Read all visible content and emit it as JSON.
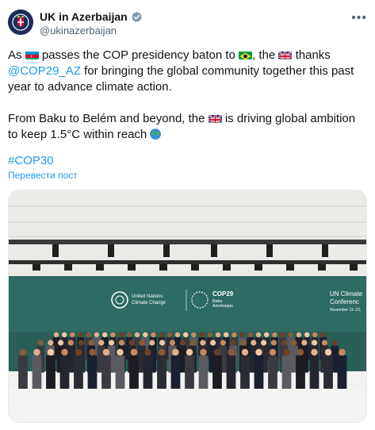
{
  "account": {
    "display_name": "UK in Azerbaijan",
    "handle": "@ukinazerbaijan",
    "avatar": "uk-crest-avatar",
    "verified_icon": "verified-badge-icon"
  },
  "post": {
    "p1_a": "As",
    "p1_b": "passes the COP presidency baton to",
    "p1_c": ", the",
    "p1_d": "thanks",
    "mention": "@COP29_AZ",
    "p1_e": "for bringing the global community together this past year to advance climate action.",
    "p2_a": "From Baku to Belém and beyond, the",
    "p2_b": "is driving global ambition to keep 1.5°C within reach",
    "hashtag": "#COP30",
    "translate_label": "Перевести пост"
  },
  "photo": {
    "un_line1": "United Nations",
    "un_line2": "Climate Change",
    "cop_line1": "COP29",
    "cop_line2": "Baku",
    "cop_line3": "Azerbaijan",
    "conf_line1": "UN Climate",
    "conf_line2": "Conferenc",
    "conf_line3": "November 11–22,"
  },
  "colors": {
    "link": "#1d9bf0",
    "muted": "#536471",
    "banner": "#2d6b63"
  }
}
